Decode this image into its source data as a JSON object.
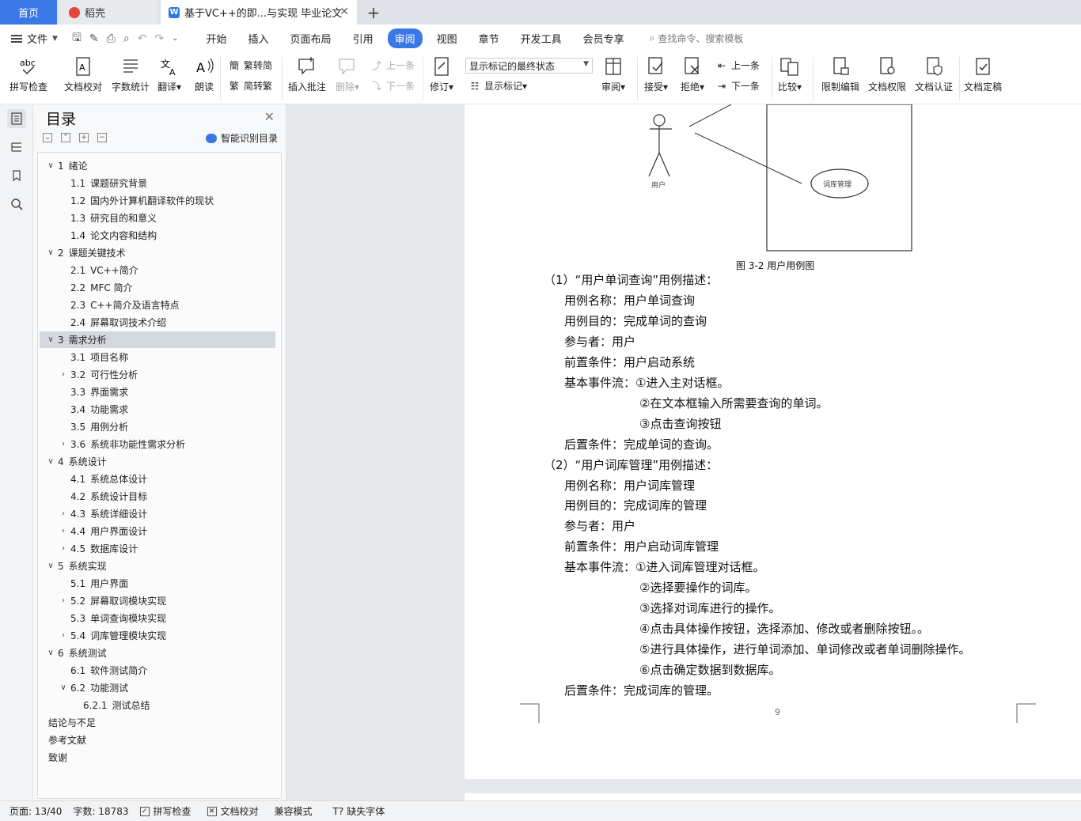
{
  "tabs": {
    "home": "首页",
    "docer": "稻壳",
    "doc": "基于VC++的即...与实现 毕业论文",
    "doc_icon": "W"
  },
  "menu": {
    "file": "文件",
    "tabs": [
      "开始",
      "插入",
      "页面布局",
      "引用",
      "审阅",
      "视图",
      "章节",
      "开发工具",
      "会员专享"
    ],
    "active_tab": "审阅",
    "search": "查找命令、搜索模板"
  },
  "ribbon": {
    "spell_check": "拼写检查",
    "doc_proof": "文档校对",
    "word_count": "字数统计",
    "translate": "翻译",
    "read_aloud": "朗读",
    "trad_to_simp": "繁转简",
    "simp_to_trad": "简转繁",
    "insert_comment": "插入批注",
    "delete": "删除",
    "prev_comment": "上一条",
    "next_comment": "下一条",
    "revise": "修订",
    "markup_select": "显示标记的最终状态",
    "show_markup": "显示标记",
    "review": "审阅",
    "accept": "接受",
    "reject": "拒绝",
    "prev_change": "上一条",
    "next_change": "下一条",
    "compare": "比较",
    "restrict_edit": "限制编辑",
    "doc_permission": "文档权限",
    "doc_certify": "文档认证",
    "doc_finalize": "文档定稿"
  },
  "toc": {
    "title": "目录",
    "smart": "智能识别目录",
    "items": [
      {
        "num": "1",
        "text": "绪论",
        "level": 0,
        "caret": "open"
      },
      {
        "num": "1.1",
        "text": "课题研究背景",
        "level": 1,
        "caret": ""
      },
      {
        "num": "1.2",
        "text": "国内外计算机翻译软件的现状",
        "level": 1,
        "caret": ""
      },
      {
        "num": "1.3",
        "text": "研究目的和意义",
        "level": 1,
        "caret": ""
      },
      {
        "num": "1.4",
        "text": "论文内容和结构",
        "level": 1,
        "caret": ""
      },
      {
        "num": "2",
        "text": "课题关键技术",
        "level": 0,
        "caret": "open"
      },
      {
        "num": "2.1",
        "text": "VC++简介",
        "level": 1,
        "caret": ""
      },
      {
        "num": "2.2",
        "text": "MFC 简介",
        "level": 1,
        "caret": ""
      },
      {
        "num": "2.3",
        "text": "C++简介及语言特点",
        "level": 1,
        "caret": ""
      },
      {
        "num": "2.4",
        "text": "屏幕取词技术介绍",
        "level": 1,
        "caret": ""
      },
      {
        "num": "3",
        "text": "需求分析",
        "level": 0,
        "caret": "open",
        "selected": true
      },
      {
        "num": "3.1",
        "text": "项目名称",
        "level": 1,
        "caret": ""
      },
      {
        "num": "3.2",
        "text": "可行性分析",
        "level": 1,
        "caret": "closed"
      },
      {
        "num": "3.3",
        "text": "界面需求",
        "level": 1,
        "caret": ""
      },
      {
        "num": "3.4",
        "text": "功能需求",
        "level": 1,
        "caret": ""
      },
      {
        "num": "3.5",
        "text": "用例分析",
        "level": 1,
        "caret": ""
      },
      {
        "num": "3.6",
        "text": "系统非功能性需求分析",
        "level": 1,
        "caret": "closed"
      },
      {
        "num": "4",
        "text": "系统设计",
        "level": 0,
        "caret": "open"
      },
      {
        "num": "4.1",
        "text": "系统总体设计",
        "level": 1,
        "caret": ""
      },
      {
        "num": "4.2",
        "text": "系统设计目标",
        "level": 1,
        "caret": ""
      },
      {
        "num": "4.3",
        "text": "系统详细设计",
        "level": 1,
        "caret": "closed"
      },
      {
        "num": "4.4",
        "text": "用户界面设计",
        "level": 1,
        "caret": "closed"
      },
      {
        "num": "4.5",
        "text": "数据库设计",
        "level": 1,
        "caret": "closed"
      },
      {
        "num": "5",
        "text": "系统实现",
        "level": 0,
        "caret": "open"
      },
      {
        "num": "5.1",
        "text": "用户界面",
        "level": 1,
        "caret": ""
      },
      {
        "num": "5.2",
        "text": "屏幕取词模块实现",
        "level": 1,
        "caret": "closed"
      },
      {
        "num": "5.3",
        "text": "单词查询模块实现",
        "level": 1,
        "caret": ""
      },
      {
        "num": "5.4",
        "text": "词库管理模块实现",
        "level": 1,
        "caret": "closed"
      },
      {
        "num": "6",
        "text": "系统测试",
        "level": 0,
        "caret": "open"
      },
      {
        "num": "6.1",
        "text": "软件测试简介",
        "level": 1,
        "caret": ""
      },
      {
        "num": "6.2",
        "text": "功能测试",
        "level": 1,
        "caret": "open"
      },
      {
        "num": "6.2.1",
        "text": "测试总结",
        "level": 2,
        "caret": ""
      },
      {
        "num": "",
        "text": "结论与不足",
        "level": 0,
        "caret": ""
      },
      {
        "num": "",
        "text": "参考文献",
        "level": 0,
        "caret": ""
      },
      {
        "num": "",
        "text": "致谢",
        "level": 0,
        "caret": ""
      }
    ]
  },
  "diagram": {
    "actor_label": "用户",
    "usecase_label": "词库管理",
    "caption": "图 3-2 用户用例图"
  },
  "doc_lines": [
    {
      "text": "（1）“用户单词查询”用例描述：",
      "indent": 0
    },
    {
      "text": "用例名称：用户单词查询",
      "indent": 1
    },
    {
      "text": "用例目的：完成单词的查询",
      "indent": 1
    },
    {
      "text": "参与者：用户",
      "indent": 1
    },
    {
      "text": "前置条件：用户启动系统",
      "indent": 1
    },
    {
      "text": "基本事件流：①进入主对话框。",
      "indent": 1
    },
    {
      "text": "②在文本框输入所需要查询的单词。",
      "indent": 2
    },
    {
      "text": "③点击查询按钮",
      "indent": 2
    },
    {
      "text": "后置条件：完成单词的查询。",
      "indent": 1
    },
    {
      "text": "（2）“用户词库管理”用例描述：",
      "indent": 0
    },
    {
      "text": "用例名称：用户词库管理",
      "indent": 1
    },
    {
      "text": "用例目的：完成词库的管理",
      "indent": 1
    },
    {
      "text": "参与者：用户",
      "indent": 1
    },
    {
      "text": "前置条件：用户启动词库管理",
      "indent": 1
    },
    {
      "text": "基本事件流：①进入词库管理对话框。",
      "indent": 1
    },
    {
      "text": "②选择要操作的词库。",
      "indent": 2
    },
    {
      "text": "③选择对词库进行的操作。",
      "indent": 2
    },
    {
      "text": "④点击具体操作按钮，选择添加、修改或者删除按钮。。",
      "indent": 2
    },
    {
      "text": "⑤进行具体操作，进行单词添加、单词修改或者单词删除操作。",
      "indent": 2
    },
    {
      "text": "⑥点击确定数据到数据库。",
      "indent": 2
    },
    {
      "text": "后置条件：完成词库的管理。",
      "indent": 1
    }
  ],
  "page_number": "9",
  "status": {
    "page": "页面: 13/40",
    "words": "字数: 18783",
    "spell": "拼写检查",
    "proof": "文档校对",
    "compat": "兼容模式",
    "missing_font": "缺失字体"
  },
  "colors": {
    "accent": "#3b78e7",
    "toc_selected": "#d3d7de"
  }
}
